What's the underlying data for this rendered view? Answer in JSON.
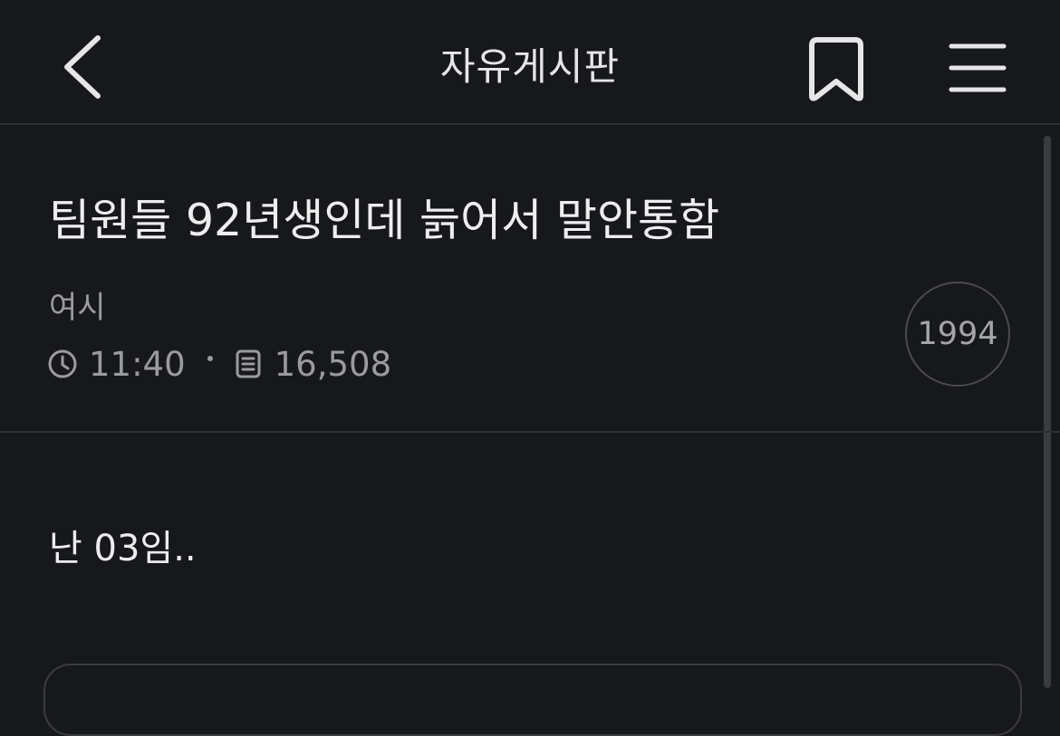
{
  "header": {
    "title": "자유게시판",
    "icons": {
      "back": "chevron-left-icon",
      "bookmark": "bookmark-icon",
      "menu": "hamburger-menu-icon"
    }
  },
  "post": {
    "title": "팀원들 92년생인데 늙어서 말안통함",
    "author": "여시",
    "time": "11:40",
    "views": "16,508",
    "year_badge": "1994",
    "body": "난 03임.."
  },
  "colors": {
    "background": "#17181c",
    "text_primary": "#eeeeef",
    "text_secondary": "#9a9ba0",
    "divider": "#2e2f34"
  }
}
